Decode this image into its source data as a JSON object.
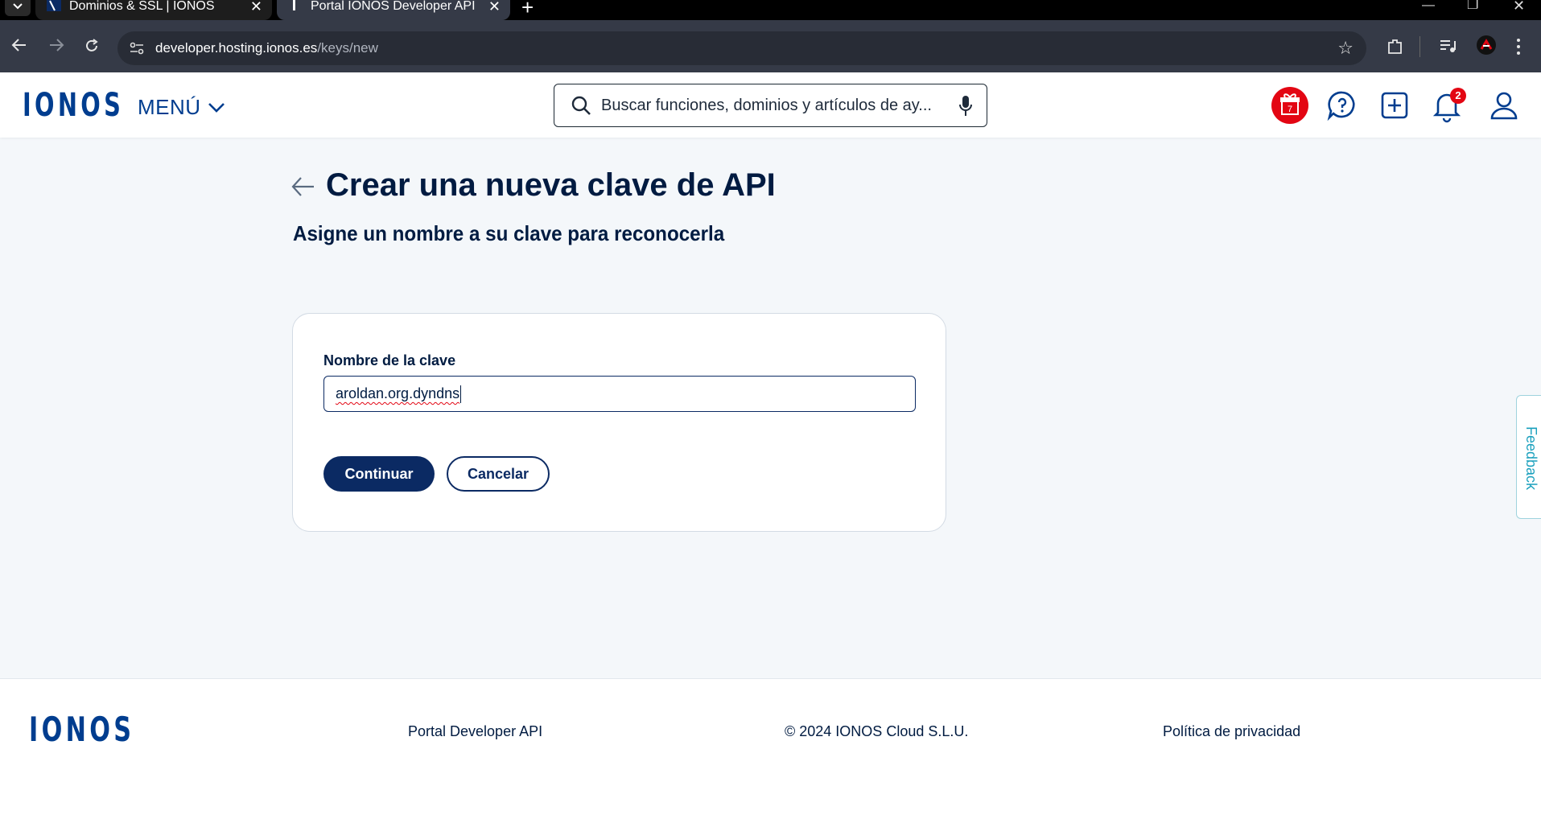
{
  "browser": {
    "tabs": [
      {
        "title": "Dominios & SSL | IONOS",
        "active": false
      },
      {
        "title": "Portal IONOS Developer API",
        "active": true
      }
    ],
    "url_host": "developer.hosting.ionos.es",
    "url_path": "/keys/new"
  },
  "header": {
    "logo": "IONOS",
    "menu_label": "MENÚ",
    "search_placeholder": "Buscar funciones, dominios y artículos de ay...",
    "gift_count": "7",
    "notifications_count": "2"
  },
  "main": {
    "title": "Crear una nueva clave de API",
    "subtitle": "Asigne un nombre a su clave para reconocerla",
    "form": {
      "field_label": "Nombre de la clave",
      "field_value": "aroldan.org.dyndns",
      "continue_label": "Continuar",
      "cancel_label": "Cancelar"
    },
    "feedback_label": "Feedback"
  },
  "footer": {
    "logo": "IONOS",
    "portal_link": "Portal Developer API",
    "copyright": "© 2024 IONOS Cloud S.L.U.",
    "privacy_link": "Política de privacidad"
  },
  "colors": {
    "brand": "#003d8f",
    "primary_button": "#0b2a63",
    "alert": "#e30613",
    "page_bg": "#f4f7fa"
  }
}
